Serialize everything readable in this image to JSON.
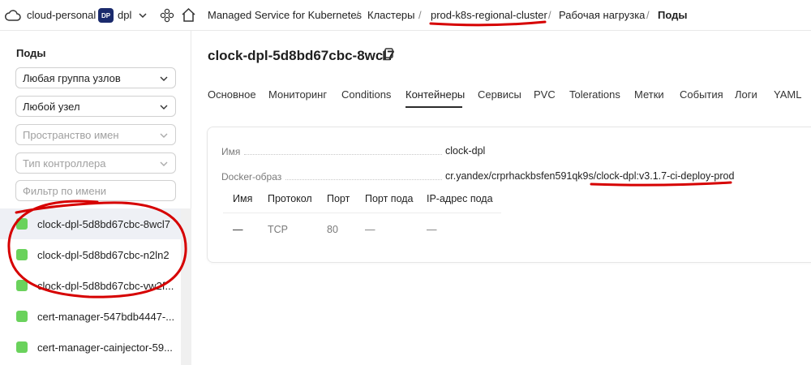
{
  "topbar": {
    "cloud_label": "cloud-personal",
    "folder_badge": "DP",
    "folder_label": "dpl",
    "breadcrumbs": [
      "Managed Service for Kubernetes",
      "Кластеры",
      "prod-k8s-regional-cluster",
      "Рабочая нагрузка",
      "Поды"
    ],
    "separator": "/"
  },
  "sidebar": {
    "title": "Поды",
    "node_group_select": "Любая группа узлов",
    "node_select": "Любой узел",
    "namespace_placeholder": "Пространство имен",
    "controller_placeholder": "Тип контроллера",
    "name_filter_placeholder": "Фильтр по имени",
    "pods": [
      {
        "name": "clock-dpl-5d8bd67cbc-8wcl7",
        "status_color": "#6ad25c"
      },
      {
        "name": "clock-dpl-5d8bd67cbc-n2ln2",
        "status_color": "#6ad25c"
      },
      {
        "name": "clock-dpl-5d8bd67cbc-vw2f...",
        "status_color": "#6ad25c"
      },
      {
        "name": "cert-manager-547bdb4447-...",
        "status_color": "#6ad25c"
      },
      {
        "name": "cert-manager-cainjector-59...",
        "status_color": "#6ad25c"
      }
    ]
  },
  "main": {
    "title": "clock-dpl-5d8bd67cbc-8wcl7",
    "tabs": [
      "Основное",
      "Мониторинг",
      "Conditions",
      "Контейнеры",
      "Сервисы",
      "PVC",
      "Tolerations",
      "Метки",
      "События",
      "Логи",
      "YAML"
    ],
    "active_tab": "Контейнеры",
    "container": {
      "name_label": "Имя",
      "name_value": "clock-dpl",
      "image_label": "Docker-образ",
      "image_value": "cr.yandex/crprhackbsfen591qk9s/clock-dpl:v3.1.7-ci-deploy-prod"
    },
    "ports": {
      "headers": [
        "Имя",
        "Протокол",
        "Порт",
        "Порт пода",
        "IP-адрес пода"
      ],
      "rows": [
        [
          "—",
          "TCP",
          "80",
          "—",
          "—"
        ]
      ]
    }
  },
  "colors": {
    "accent": "#1a2a6c",
    "status_ok": "#6ad25c",
    "annotation": "#d60000"
  }
}
